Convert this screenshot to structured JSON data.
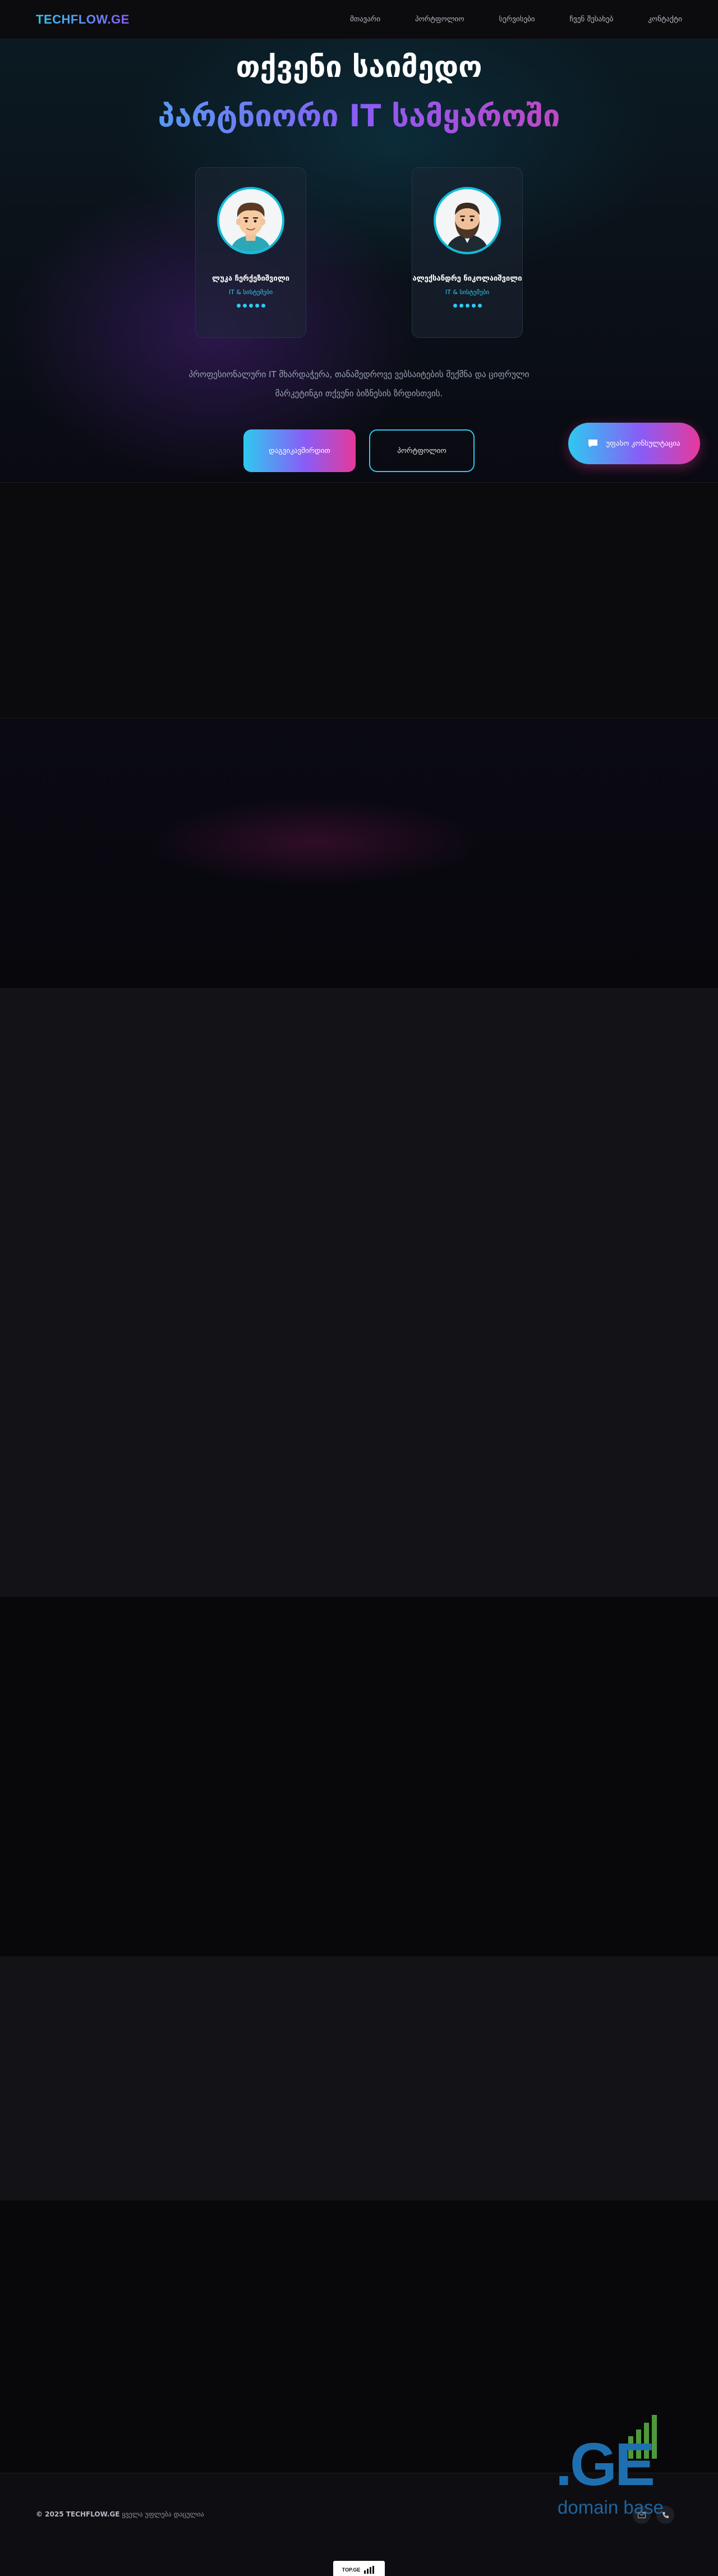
{
  "navbar": {
    "logo": "TECHFLOW.GE",
    "links": [
      "მთავარი",
      "პორტფოლიო",
      "სერვისები",
      "ჩვენ შესახებ",
      "კონტაქტი"
    ]
  },
  "hero": {
    "title_line1": "თქვენი საიმედო",
    "title_line2": "პარტნიორი IT სამყაროში",
    "description": "პროფესიონალური IT მხარდაჭერა, თანამედროვე ვებსაიტების შექმნა და ციფრული მარკეტინგი თქვენი ბიზნესის ზრდისთვის.",
    "primary_button": "დაგვიკავშირდით",
    "secondary_button": "პორტფოლიო"
  },
  "team": [
    {
      "name": "ლუკა ჩერქეზიშვილი",
      "role": "IT & სისტემები",
      "rating": 5
    },
    {
      "name": "ალექსანდრე ნიკოლაიშვილი",
      "role": "IT & სისტემები",
      "rating": 5
    }
  ],
  "floating_button": {
    "label": "უფასო კონსულტაცია",
    "icon": "chat-icon"
  },
  "footer": {
    "copyright_brand": "© 2025 TECHFLOW.GE",
    "copyright_rest": "ყველა უფლება დაცულია",
    "icons": [
      "mail-icon",
      "phone-icon"
    ],
    "badge": "TOP.GE"
  },
  "watermark": {
    "mark": ".GE",
    "text": "domain base"
  },
  "colors": {
    "cyan": "#2ec9f0",
    "purple": "#8a5cf6",
    "pink": "#e6399b",
    "background": "#0d0d10"
  }
}
